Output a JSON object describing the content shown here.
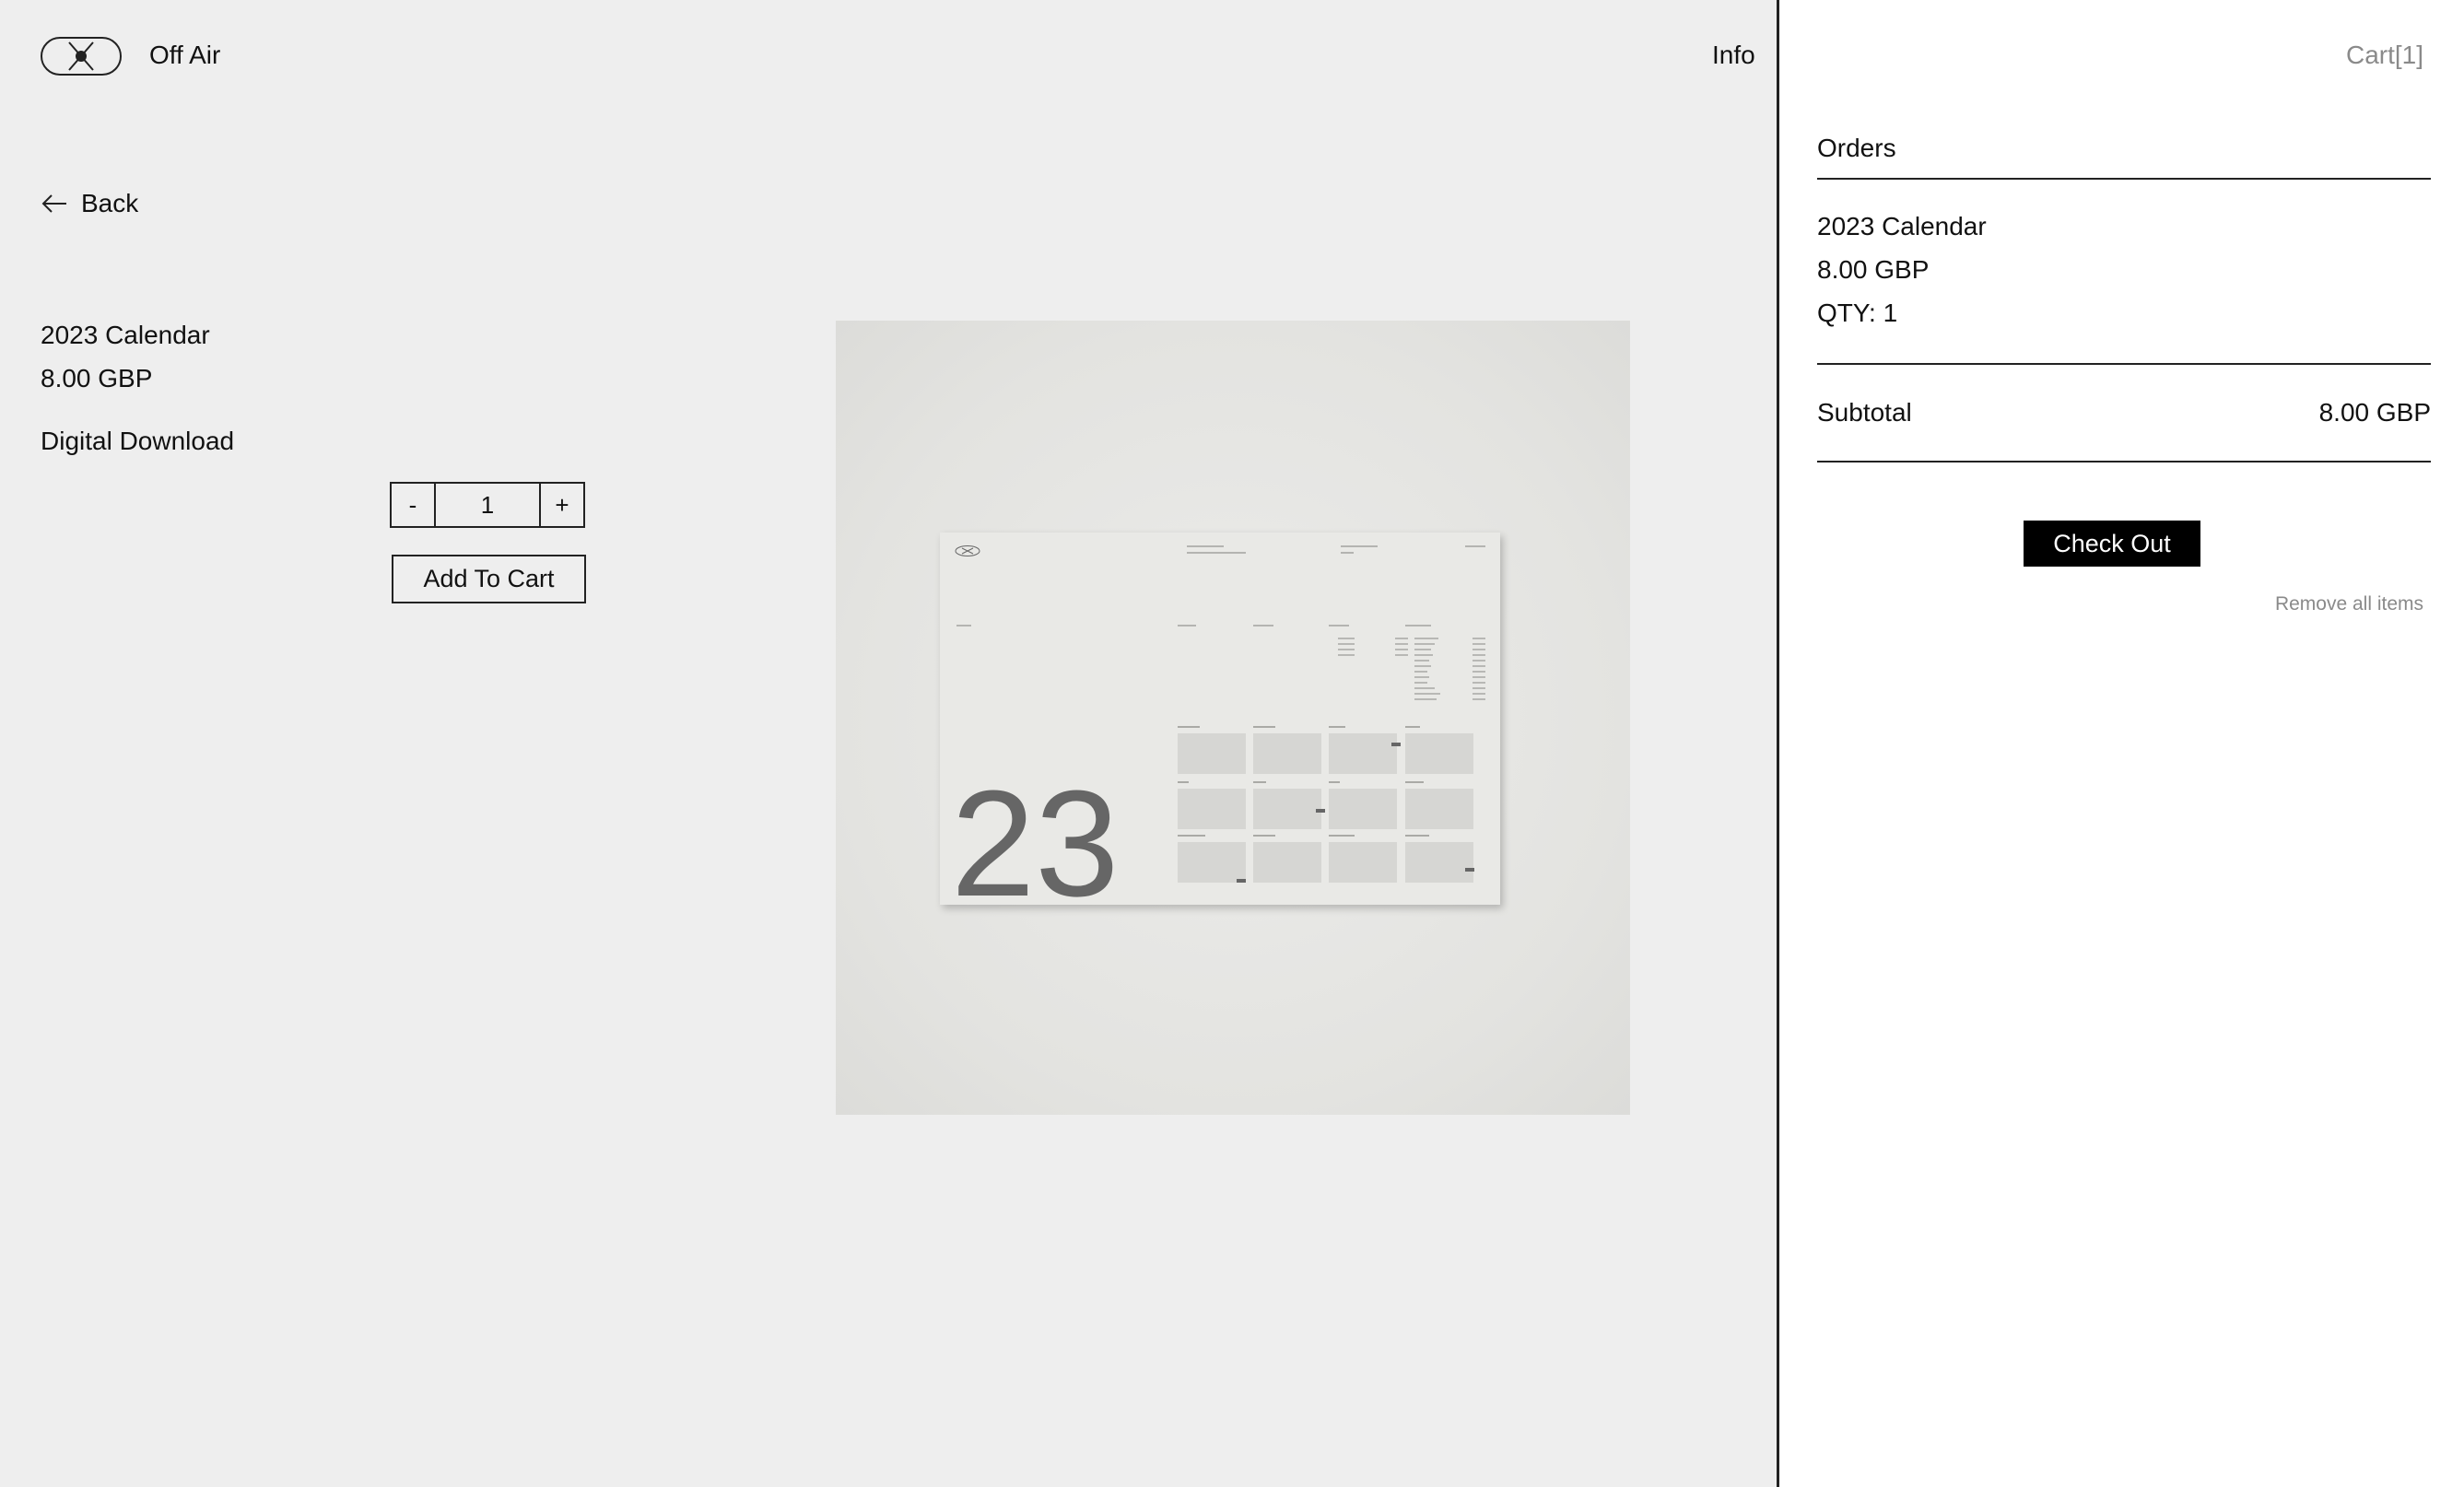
{
  "header": {
    "brand": "Off Air",
    "logo_icon": "circle-x-logo-icon",
    "nav_info": "Info"
  },
  "nav": {
    "back_label": "Back",
    "back_icon": "arrow-left-icon"
  },
  "product": {
    "title": "2023 Calendar",
    "price": "8.00 GBP",
    "format": "Digital Download",
    "quantity": "1",
    "decrement_label": "-",
    "increment_label": "+",
    "add_to_cart_label": "Add To Cart",
    "image": {
      "subject": "calendar-poster",
      "big_number": "23"
    }
  },
  "cart": {
    "toggle_label": "Cart[1]",
    "orders_heading": "Orders",
    "item": {
      "title": "2023 Calendar",
      "price": "8.00 GBP",
      "qty": "QTY: 1"
    },
    "subtotal_label": "Subtotal",
    "subtotal_value": "8.00 GBP",
    "checkout_label": "Check Out",
    "remove_all_label": "Remove all items"
  },
  "colors": {
    "page_bg": "#eeeeee",
    "cart_bg": "#ffffff",
    "text": "#111111",
    "muted": "#8a8a8a",
    "checkout_bg": "#000000"
  }
}
